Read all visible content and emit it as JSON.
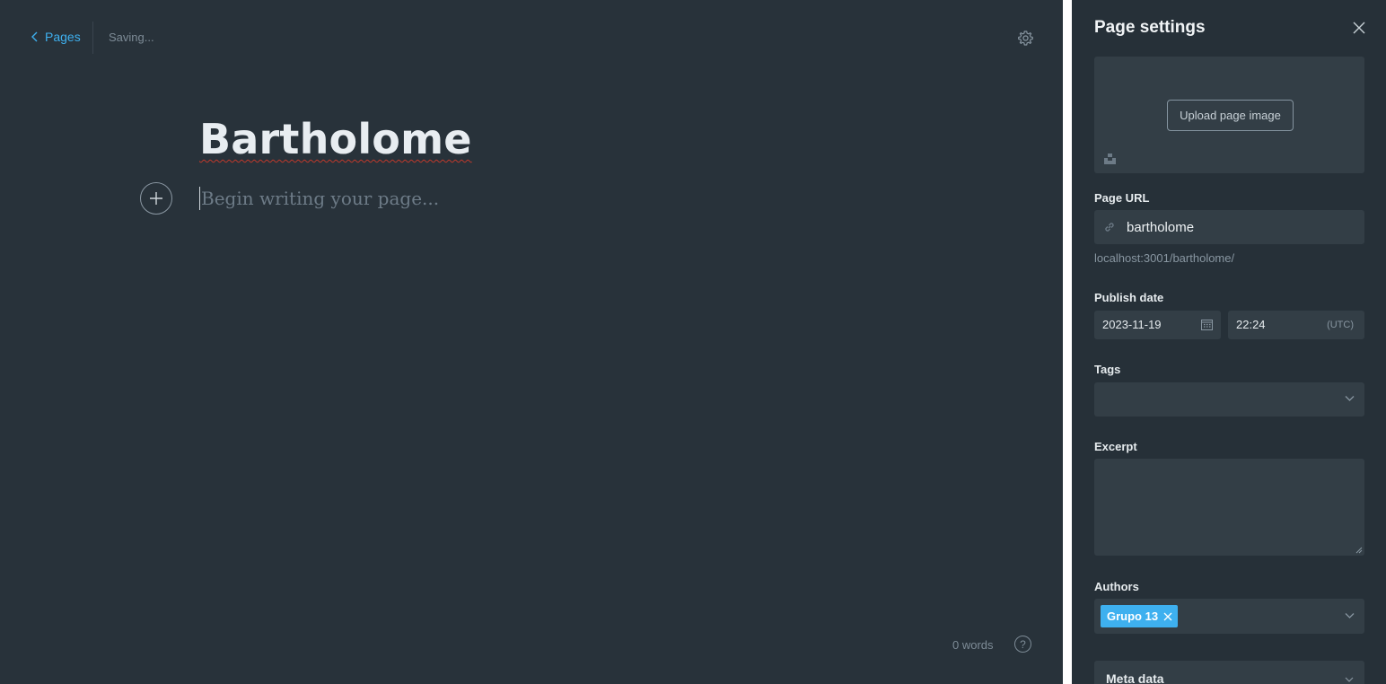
{
  "editor": {
    "back_label": "Pages",
    "status": "Saving...",
    "title": "Bartholome",
    "body_placeholder": "Begin writing your page...",
    "word_count": "0 words",
    "help_label": "?"
  },
  "panel": {
    "title": "Page settings",
    "upload_label": "Upload page image",
    "url_label": "Page URL",
    "url_value": "bartholome",
    "url_hint": "localhost:3001/bartholome/",
    "publish_label": "Publish date",
    "date_value": "2023-11-19",
    "time_value": "22:24",
    "timezone": "(UTC)",
    "tags_label": "Tags",
    "excerpt_label": "Excerpt",
    "authors_label": "Authors",
    "author_token": "Grupo 13",
    "meta_label": "Meta data"
  },
  "colors": {
    "accent": "#3eb0ef",
    "editor_bg": "#28323a",
    "panel_bg": "#263038",
    "field_bg": "#333e46"
  },
  "icons": [
    "chevron-left-icon",
    "gear-icon",
    "plus-icon",
    "question-icon",
    "close-icon",
    "unsplash-icon",
    "link-icon",
    "calendar-icon",
    "chevron-down-icon",
    "remove-token-icon"
  ]
}
